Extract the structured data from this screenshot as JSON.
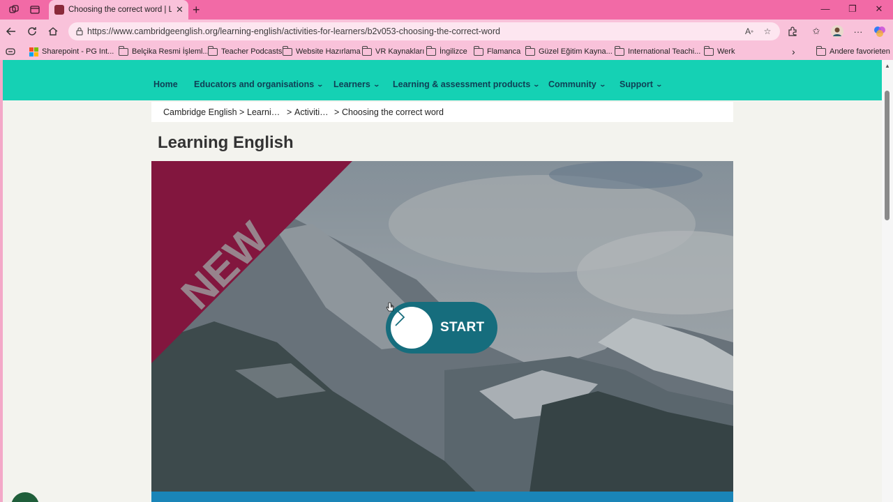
{
  "browser": {
    "tab": {
      "title": "Choosing the correct word | Learning English",
      "favicon": "cambridge-shield-icon"
    },
    "url": "https://www.cambridgeenglish.org/learning-english/activities-for-learners/b2v053-choosing-the-correct-word",
    "theme": {
      "tab_strip": "#f26aa6",
      "toolbar": "#f9c2da"
    }
  },
  "bookmarks": [
    {
      "label": "Sharepoint - PG Int...",
      "icon": "microsoft-logo-icon"
    },
    {
      "label": "Belçika Resmi İşleml...",
      "icon": "folder-icon"
    },
    {
      "label": "Teacher Podcasts",
      "icon": "folder-icon"
    },
    {
      "label": "Website Hazırlama",
      "icon": "folder-icon"
    },
    {
      "label": "VR Kaynakları",
      "icon": "folder-icon"
    },
    {
      "label": "İngilizce",
      "icon": "folder-icon"
    },
    {
      "label": "Flamanca",
      "icon": "folder-icon"
    },
    {
      "label": "Güzel Eğitim Kayna...",
      "icon": "folder-icon"
    },
    {
      "label": "International Teachi...",
      "icon": "folder-icon"
    },
    {
      "label": "Werk",
      "icon": "folder-icon"
    }
  ],
  "bookmarks_other": "Andere favorieten",
  "site_nav": [
    {
      "label": "Home",
      "dropdown": false
    },
    {
      "label": "Educators and organisations",
      "dropdown": true
    },
    {
      "label": "Learners",
      "dropdown": true
    },
    {
      "label": "Learning & assessment products",
      "dropdown": true
    },
    {
      "label": "Community",
      "dropdown": true
    },
    {
      "label": "Support",
      "dropdown": true
    }
  ],
  "breadcrumb": [
    "Cambridge English",
    "Learni…",
    "Activiti…",
    "Choosing the correct word"
  ],
  "page_title": "Learning English",
  "hero": {
    "ribbon_text": "NEW",
    "start_label": "START",
    "colors": {
      "ribbon": "#8c0f3c",
      "start_button": "#166d7d",
      "nav": "#15d1b4"
    }
  }
}
